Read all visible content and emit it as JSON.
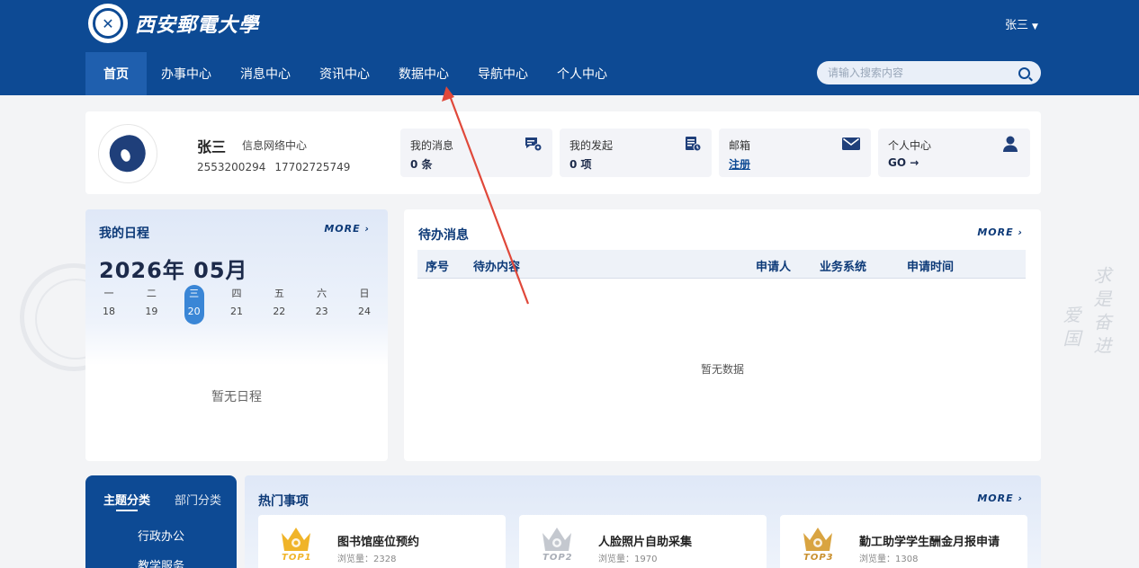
{
  "header": {
    "logo_text": "西安郵電大學",
    "user_name": "张三",
    "user_caret": "▼",
    "search_placeholder": "请输入搜索内容"
  },
  "nav": {
    "items": [
      {
        "label": "首页",
        "active": true
      },
      {
        "label": "办事中心"
      },
      {
        "label": "消息中心"
      },
      {
        "label": "资讯中心"
      },
      {
        "label": "数据中心"
      },
      {
        "label": "导航中心"
      },
      {
        "label": "个人中心"
      }
    ]
  },
  "profile": {
    "name": "张三",
    "department": "信息网络中心",
    "id_number": "2553200294",
    "phone": "17702725749"
  },
  "quick": [
    {
      "title": "我的消息",
      "value": "0 条",
      "icon": "message-icon"
    },
    {
      "title": "我的发起",
      "value": "0 项",
      "icon": "document-icon"
    },
    {
      "title": "邮箱",
      "value": "注册",
      "icon": "mail-icon"
    },
    {
      "title": "个人中心",
      "value": "GO →",
      "icon": "user-icon"
    }
  ],
  "schedule": {
    "title": "我的日程",
    "more": "MORE",
    "more_arrow": "›",
    "month": "2026年 05月",
    "days": [
      {
        "weekday": "一",
        "date": "18"
      },
      {
        "weekday": "二",
        "date": "19"
      },
      {
        "weekday": "三",
        "date": "20",
        "today": true
      },
      {
        "weekday": "四",
        "date": "21"
      },
      {
        "weekday": "五",
        "date": "22"
      },
      {
        "weekday": "六",
        "date": "23"
      },
      {
        "weekday": "日",
        "date": "24"
      }
    ],
    "empty": "暂无日程"
  },
  "todo": {
    "title": "待办消息",
    "more": "MORE",
    "more_arrow": "›",
    "columns": [
      "序号",
      "待办内容",
      "申请人",
      "业务系统",
      "申请时间"
    ],
    "empty": "暂无数据"
  },
  "categories": {
    "tabs": [
      "主题分类",
      "部门分类"
    ],
    "items": [
      "行政办公",
      "教学服务"
    ]
  },
  "hot": {
    "title": "热门事项",
    "more": "MORE",
    "more_arrow": "›",
    "items": [
      {
        "rank": "TOP1",
        "name": "图书馆座位预约",
        "views": "浏览量：2328",
        "color": "#f0b429"
      },
      {
        "rank": "TOP2",
        "name": "人脸照片自助采集",
        "views": "浏览量：1970",
        "color": "#b8bcc4"
      },
      {
        "rank": "TOP3",
        "name": "勤工助学学生酬金月报申请",
        "views": "浏览量：1308",
        "color": "#d9a441"
      }
    ]
  },
  "watermark": {
    "motto_right": "求是奋进",
    "motto_left": "爱国"
  },
  "colors": {
    "primary": "#0d4a94",
    "annotation_arrow": "#e0483a"
  }
}
